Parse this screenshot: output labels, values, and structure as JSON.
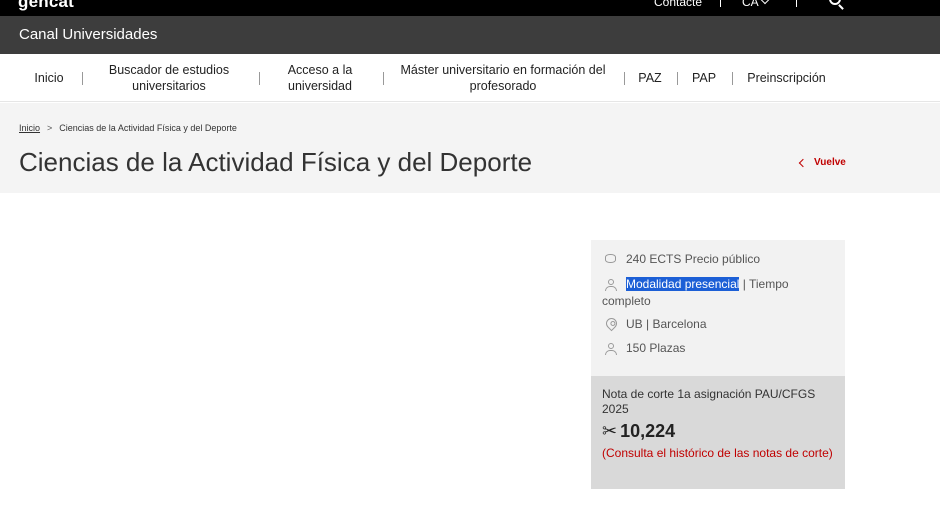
{
  "topbar": {
    "logo": "gencat",
    "contact": "Contacte",
    "language": "CA",
    "icons": {
      "search": "search-icon",
      "language_chevron": "chevron-down-icon"
    }
  },
  "channel": {
    "title": "Canal Universidades"
  },
  "nav": {
    "items": [
      {
        "label": "Inicio"
      },
      {
        "label": "Buscador de estudios universitarios"
      },
      {
        "label": "Acceso a la universidad"
      },
      {
        "label": "Máster universitario en formación del profesorado"
      },
      {
        "label": "PAZ"
      },
      {
        "label": "PAP"
      },
      {
        "label": "Preinscripción"
      }
    ]
  },
  "breadcrumb": {
    "home": "Inicio",
    "separator": ">",
    "current": "Ciencias de la Actividad Física y del Deporte"
  },
  "page": {
    "title": "Ciencias de la Actividad Física y del Deporte",
    "back": "Vuelve"
  },
  "card": {
    "ects": "240 ECTS Precio público",
    "modality_selected": "Modalidad presencial",
    "modality_rest": " | Tiempo completo",
    "location": "UB | Barcelona",
    "places": "150 Plazas",
    "icons": [
      "database-icon",
      "user-icon",
      "location-pin-icon",
      "user-icon"
    ]
  },
  "cutoff": {
    "label": "Nota de corte 1a asignación PAU/CFGS 2025",
    "value": "10,224",
    "link": "(Consulta el histórico de las notas de corte)",
    "icon": "scissors-icon"
  },
  "colors": {
    "topbar": "#000000",
    "channelbar": "#3d3d3d",
    "accent_red": "#c00000",
    "selection": "#1c5fd6",
    "card_bg": "#f2f2f2",
    "cutoff_bg": "#d9d9d9"
  }
}
